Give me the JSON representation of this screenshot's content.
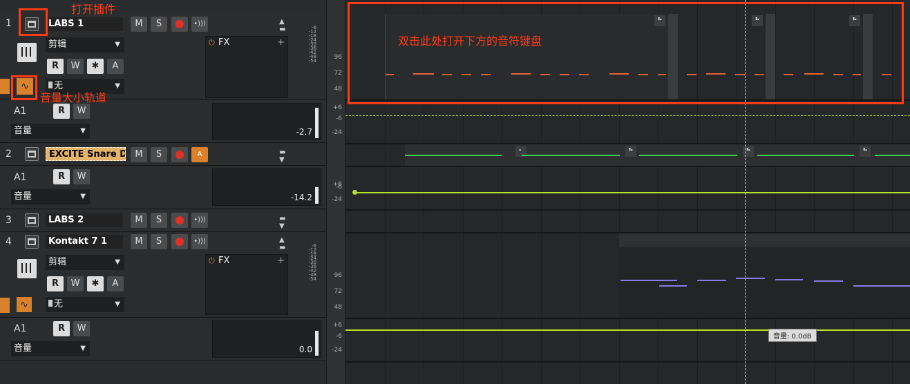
{
  "annotations": {
    "open_plugin": "打开插件",
    "volume_track": "音量大小轨道",
    "double_click_hint": "双击此处打开下方的音符键盘"
  },
  "buttons": {
    "mute": "M",
    "solo": "S",
    "read": "R",
    "write": "W",
    "star": "✱",
    "auto": "A",
    "monitor": "•)))",
    "monitor_a": "A"
  },
  "tracks": [
    {
      "number": "1",
      "name": "LABS 1",
      "clip_dropdown": "剪辑",
      "fx_label": "FX",
      "input": "无",
      "sub_channel": "A1",
      "sub_param": "音量",
      "sub_value": "-2.7"
    },
    {
      "number": "2",
      "name": "EXCITE Snare Dr",
      "sub_channel": "A1",
      "sub_param": "音量",
      "sub_value": "-14.2"
    },
    {
      "number": "3",
      "name": "LABS 2"
    },
    {
      "number": "4",
      "name": "Kontakt 7 1",
      "clip_dropdown": "剪辑",
      "fx_label": "FX",
      "input": "无",
      "sub_channel": "A1",
      "sub_param": "音量",
      "sub_value": "0.0"
    }
  ],
  "meter_scale": [
    "-6",
    "-12",
    "-18",
    "-24",
    "-30",
    "-36",
    "-42",
    "-48",
    "-54"
  ],
  "vol_scale": [
    "+6",
    "-6",
    "-24"
  ],
  "ruler": {
    "t1": [
      "96",
      "72",
      "48"
    ],
    "t4": [
      "96",
      "72",
      "48"
    ]
  },
  "tooltip": "音量: 0.0dB",
  "colors": {
    "accent": "#ff3b14",
    "track2_note": "#35d05a",
    "track4_note": "#8a78e6",
    "track1_note": "#e0643a",
    "volume_line": "#b8e02a"
  }
}
